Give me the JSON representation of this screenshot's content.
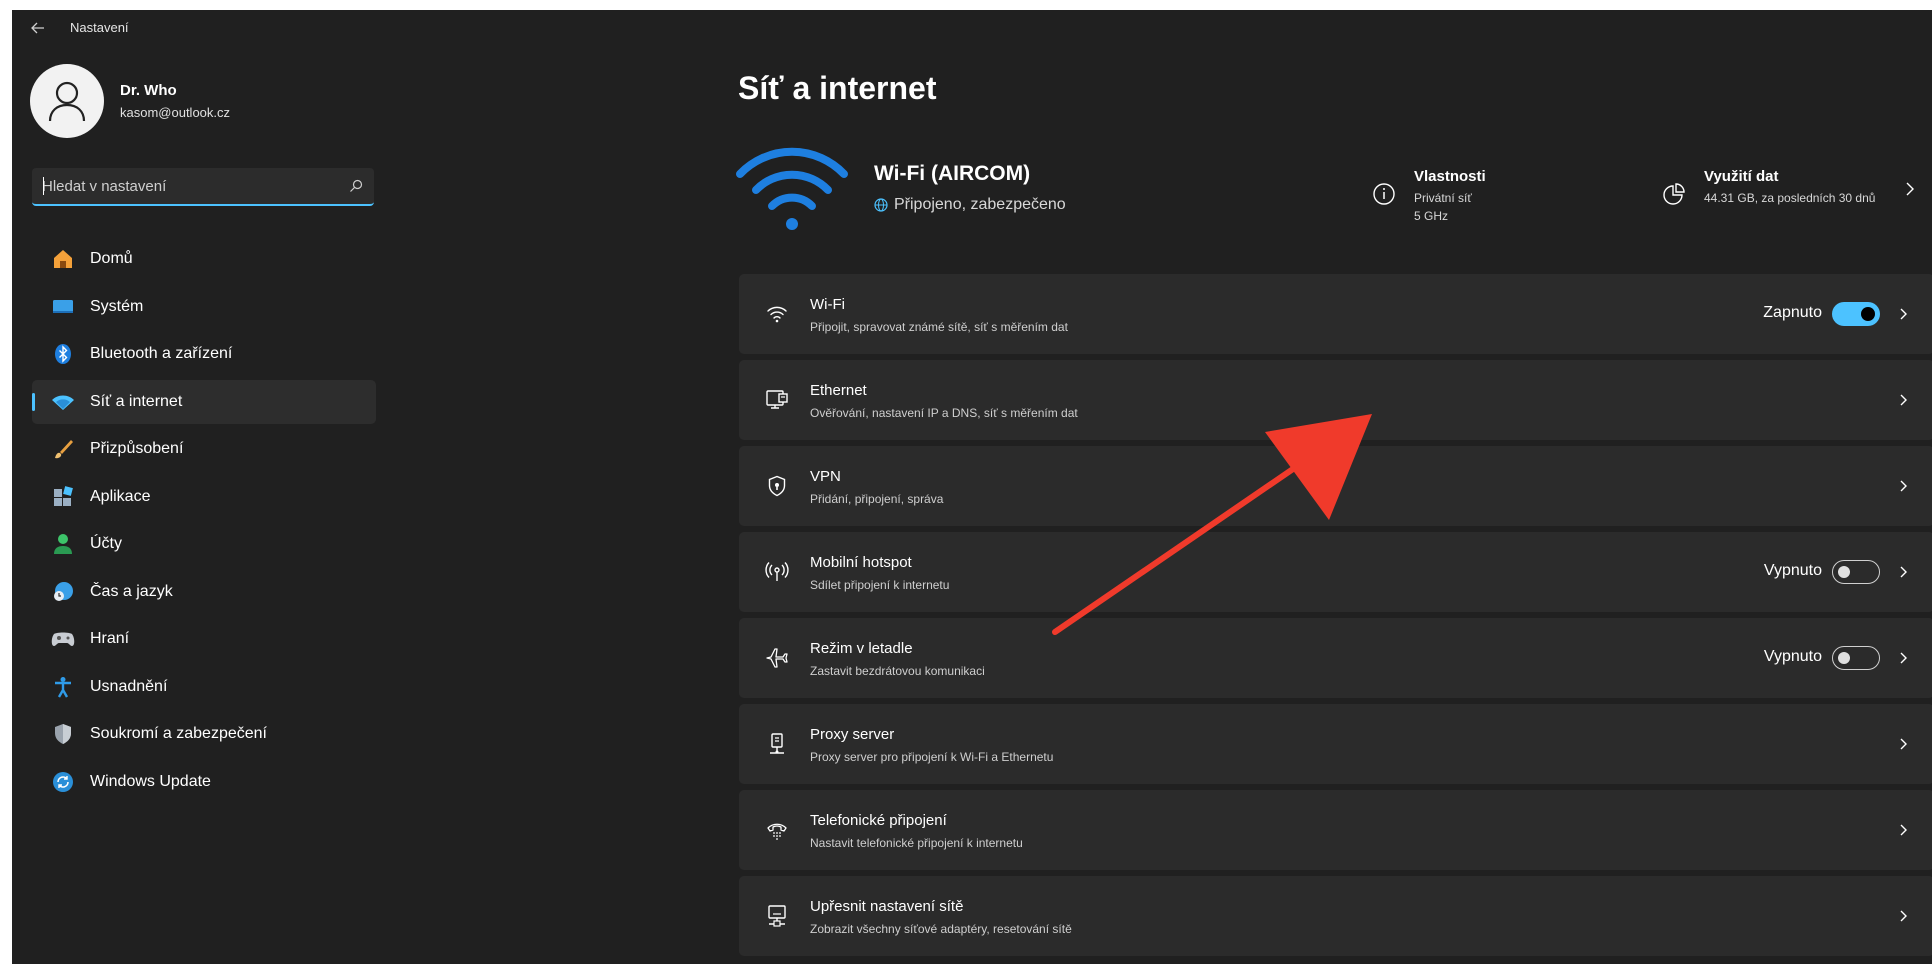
{
  "window": {
    "title": "Nastavení"
  },
  "profile": {
    "name": "Dr. Who",
    "email": "kasom@outlook.cz"
  },
  "search": {
    "placeholder": "Hledat v nastavení"
  },
  "nav": {
    "items": [
      {
        "label": "Domů",
        "icon": "home-icon"
      },
      {
        "label": "Systém",
        "icon": "system-icon"
      },
      {
        "label": "Bluetooth a zařízení",
        "icon": "bluetooth-icon"
      },
      {
        "label": "Síť a internet",
        "icon": "network-icon",
        "active": true
      },
      {
        "label": "Přizpůsobení",
        "icon": "brush-icon"
      },
      {
        "label": "Aplikace",
        "icon": "apps-icon"
      },
      {
        "label": "Účty",
        "icon": "person-icon"
      },
      {
        "label": "Čas a jazyk",
        "icon": "globe-clock-icon"
      },
      {
        "label": "Hraní",
        "icon": "gamepad-icon"
      },
      {
        "label": "Usnadnění",
        "icon": "accessibility-icon"
      },
      {
        "label": "Soukromí a zabezpečení",
        "icon": "shield-icon"
      },
      {
        "label": "Windows Update",
        "icon": "update-icon"
      }
    ]
  },
  "main": {
    "title": "Síť a internet",
    "connection": {
      "name": "Wi-Fi (AIRCOM)",
      "status": "Připojeno, zabezpečeno"
    },
    "properties": {
      "title": "Vlastnosti",
      "line1": "Privátní síť",
      "line2": "5 GHz"
    },
    "usage": {
      "title": "Využití dat",
      "subtitle": "44.31 GB, za posledních 30 dnů"
    },
    "cards": [
      {
        "title": "Wi-Fi",
        "subtitle": "Připojit, spravovat známé sítě, síť s měřením dat",
        "icon": "wifi-icon",
        "state": "Zapnuto",
        "toggle_on": true
      },
      {
        "title": "Ethernet",
        "subtitle": "Ověřování, nastavení IP a DNS, síť s měřením dat",
        "icon": "ethernet-icon"
      },
      {
        "title": "VPN",
        "subtitle": "Přidání, připojení, správa",
        "icon": "vpn-shield-icon"
      },
      {
        "title": "Mobilní hotspot",
        "subtitle": "Sdílet připojení k internetu",
        "icon": "hotspot-icon",
        "state": "Vypnuto",
        "toggle_on": false
      },
      {
        "title": "Režim v letadle",
        "subtitle": "Zastavit bezdrátovou komunikaci",
        "icon": "airplane-icon",
        "state": "Vypnuto",
        "toggle_on": false
      },
      {
        "title": "Proxy server",
        "subtitle": "Proxy server pro připojení k Wi-Fi a Ethernetu",
        "icon": "proxy-icon"
      },
      {
        "title": "Telefonické připojení",
        "subtitle": "Nastavit telefonické připojení k internetu",
        "icon": "dialup-icon"
      },
      {
        "title": "Upřesnit nastavení sítě",
        "subtitle": "Zobrazit všechny síťové adaptéry, resetování sítě",
        "icon": "network-adapter-icon"
      }
    ]
  },
  "colors": {
    "accent": "#4cc2ff",
    "background": "#202020",
    "card": "#2b2b2b",
    "annotation_arrow": "#f03a2b"
  }
}
